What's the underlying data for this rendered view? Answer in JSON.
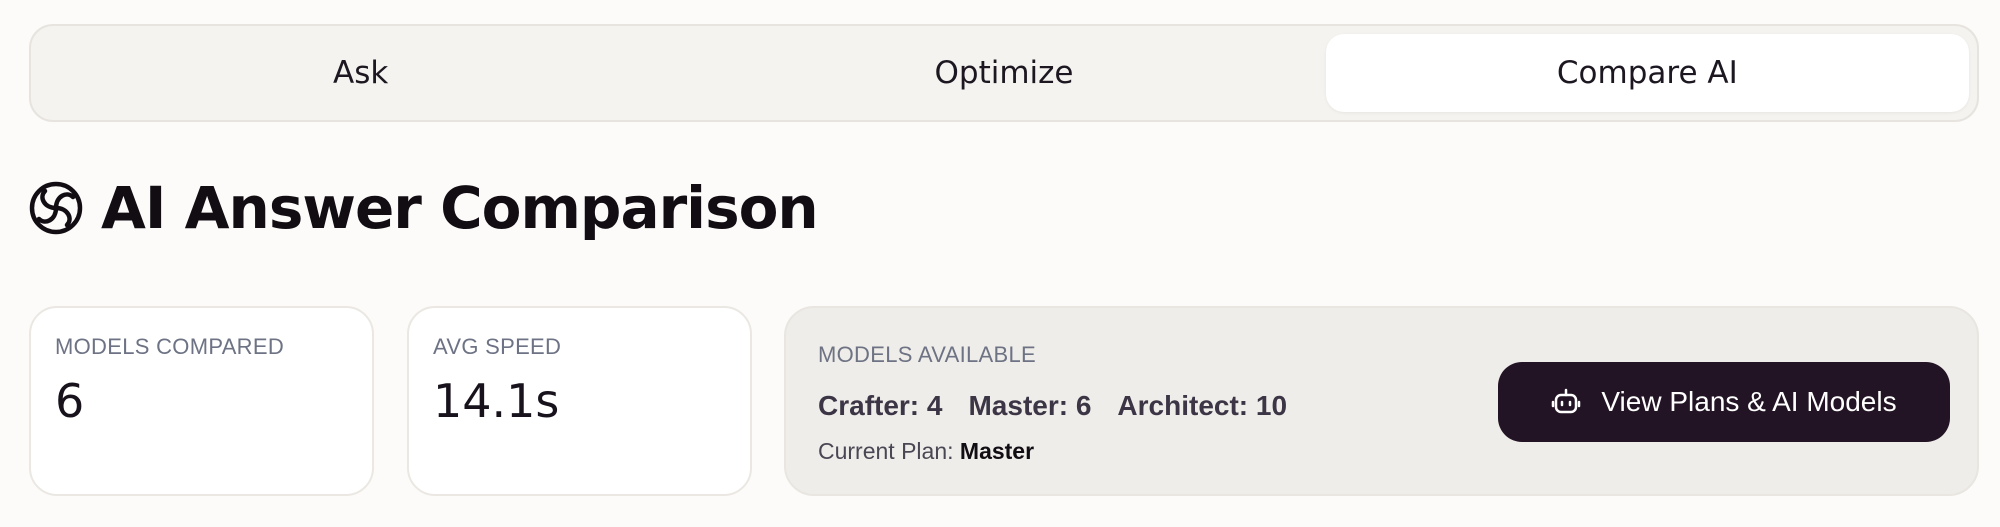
{
  "tabs": [
    {
      "label": "Ask",
      "active": false
    },
    {
      "label": "Optimize",
      "active": false
    },
    {
      "label": "Compare AI",
      "active": true
    }
  ],
  "header": {
    "title": "AI Answer Comparison",
    "icon": "spiral-icon"
  },
  "stats": {
    "models_compared": {
      "label": "MODELS COMPARED",
      "value": "6"
    },
    "avg_speed": {
      "label": "AVG SPEED",
      "value": "14.1s"
    }
  },
  "models_available": {
    "label": "MODELS AVAILABLE",
    "tiers": [
      {
        "text": "Crafter: 4"
      },
      {
        "text": "Master: 6"
      },
      {
        "text": "Architect: 10"
      }
    ],
    "current_plan_label": "Current Plan:",
    "current_plan_value": "Master",
    "button_label": "View Plans & AI Models",
    "button_icon": "robot-icon"
  },
  "colors": {
    "background": "#fcfbf9",
    "button_bg": "#231425",
    "muted_label": "#6d7384"
  }
}
